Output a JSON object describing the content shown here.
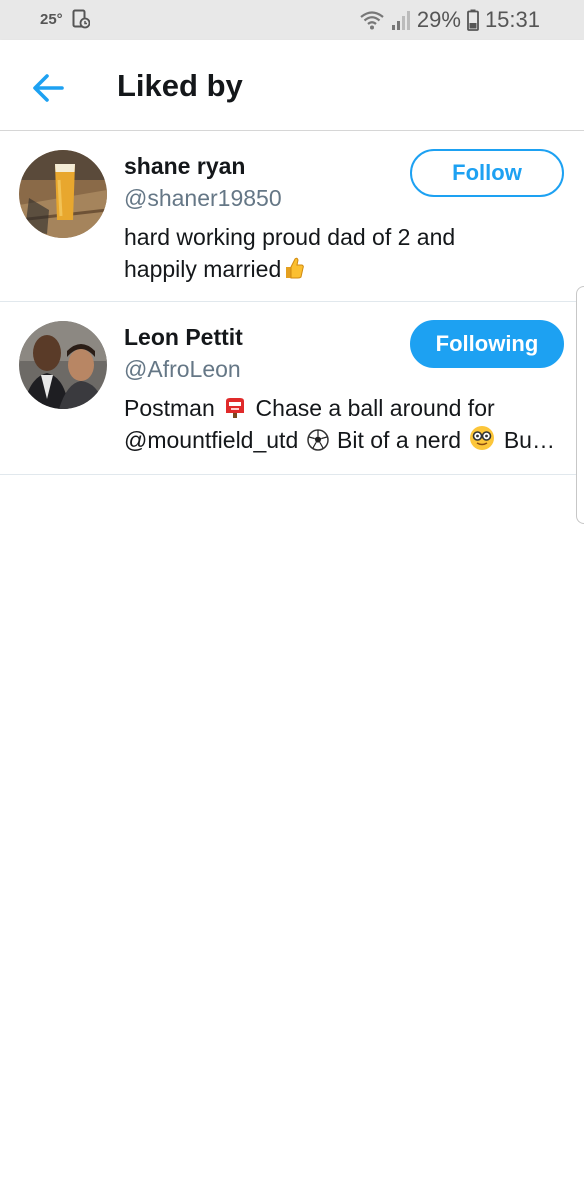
{
  "status_bar": {
    "temperature": "25°",
    "battery": "29%",
    "time": "15:31"
  },
  "header": {
    "title": "Liked by"
  },
  "users": [
    {
      "name": "shane ryan",
      "handle": "@shaner19850",
      "bio_lines": [
        "hard working proud dad of 2 and",
        "happily married"
      ],
      "button_label": "Follow"
    },
    {
      "name": "Leon Pettit",
      "handle": "@AfroLeon",
      "bio_line1": "Postman",
      "bio_line1b": "Chase a ball around for",
      "bio_line2a": "@mountfield_utd",
      "bio_line2b": "Bit of a nerd",
      "bio_line2c": "Bu…",
      "button_label": "Following"
    }
  ],
  "colors": {
    "accent": "#1da1f2",
    "secondary_text": "#657786",
    "primary_text": "#14171a"
  }
}
